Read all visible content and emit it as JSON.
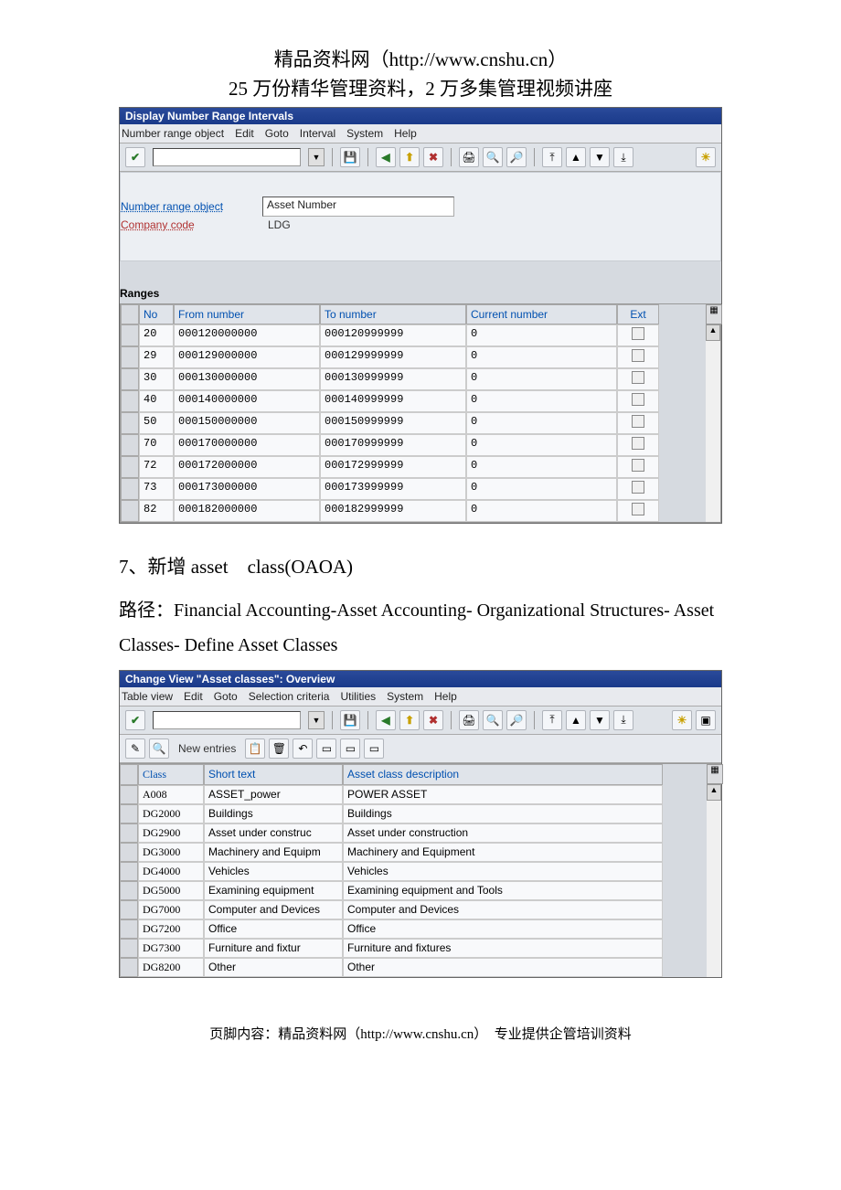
{
  "header": {
    "line1": "精品资料网（http://www.cnshu.cn）",
    "line2": "25 万份精华管理资料，2 万多集管理视频讲座"
  },
  "win1": {
    "title": "Display Number Range Intervals",
    "menu": [
      "Number range object",
      "Edit",
      "Goto",
      "Interval",
      "System",
      "Help"
    ],
    "fields": {
      "nroLabel": "Number range object",
      "nroValue": "Asset Number",
      "ccLabel": "Company code",
      "ccValue": "LDG"
    },
    "rangesLabel": "Ranges",
    "columns": {
      "no": "No",
      "from": "From number",
      "to": "To number",
      "curr": "Current number",
      "ext": "Ext"
    },
    "rows": [
      {
        "no": "20",
        "from": "000120000000",
        "to": "000120999999",
        "curr": "0"
      },
      {
        "no": "29",
        "from": "000129000000",
        "to": "000129999999",
        "curr": "0"
      },
      {
        "no": "30",
        "from": "000130000000",
        "to": "000130999999",
        "curr": "0"
      },
      {
        "no": "40",
        "from": "000140000000",
        "to": "000140999999",
        "curr": "0"
      },
      {
        "no": "50",
        "from": "000150000000",
        "to": "000150999999",
        "curr": "0"
      },
      {
        "no": "70",
        "from": "000170000000",
        "to": "000170999999",
        "curr": "0"
      },
      {
        "no": "72",
        "from": "000172000000",
        "to": "000172999999",
        "curr": "0"
      },
      {
        "no": "73",
        "from": "000173000000",
        "to": "000173999999",
        "curr": "0"
      },
      {
        "no": "82",
        "from": "000182000000",
        "to": "000182999999",
        "curr": "0"
      }
    ]
  },
  "doc": {
    "section": "7、新增 asset　class(OAOA)",
    "path": "路径：Financial Accounting-Asset Accounting- Organizational Structures- Asset Classes- Define Asset Classes"
  },
  "win2": {
    "title": "Change View \"Asset classes\": Overview",
    "menu": [
      "Table view",
      "Edit",
      "Goto",
      "Selection criteria",
      "Utilities",
      "System",
      "Help"
    ],
    "newEntries": "New entries",
    "columns": {
      "class": "Class",
      "short": "Short text",
      "desc": "Asset class description"
    },
    "rows": [
      {
        "class": "A008",
        "short": "ASSET_power",
        "desc": "POWER ASSET"
      },
      {
        "class": "DG2000",
        "short": "Buildings",
        "desc": "Buildings"
      },
      {
        "class": "DG2900",
        "short": "Asset under construc",
        "desc": "Asset under construction"
      },
      {
        "class": "DG3000",
        "short": "Machinery and Equipm",
        "desc": "Machinery and Equipment"
      },
      {
        "class": "DG4000",
        "short": "Vehicles",
        "desc": "Vehicles"
      },
      {
        "class": "DG5000",
        "short": "Examining equipment",
        "desc": "Examining equipment and Tools"
      },
      {
        "class": "DG7000",
        "short": "Computer and Devices",
        "desc": "Computer and Devices"
      },
      {
        "class": "DG7200",
        "short": "Office",
        "desc": "Office"
      },
      {
        "class": "DG7300",
        "short": "Furniture and fixtur",
        "desc": "Furniture and fixtures"
      },
      {
        "class": "DG8200",
        "short": "Other",
        "desc": "Other"
      }
    ]
  },
  "footer": "页脚内容：精品资料网（http://www.cnshu.cn）　专业提供企管培训资料"
}
